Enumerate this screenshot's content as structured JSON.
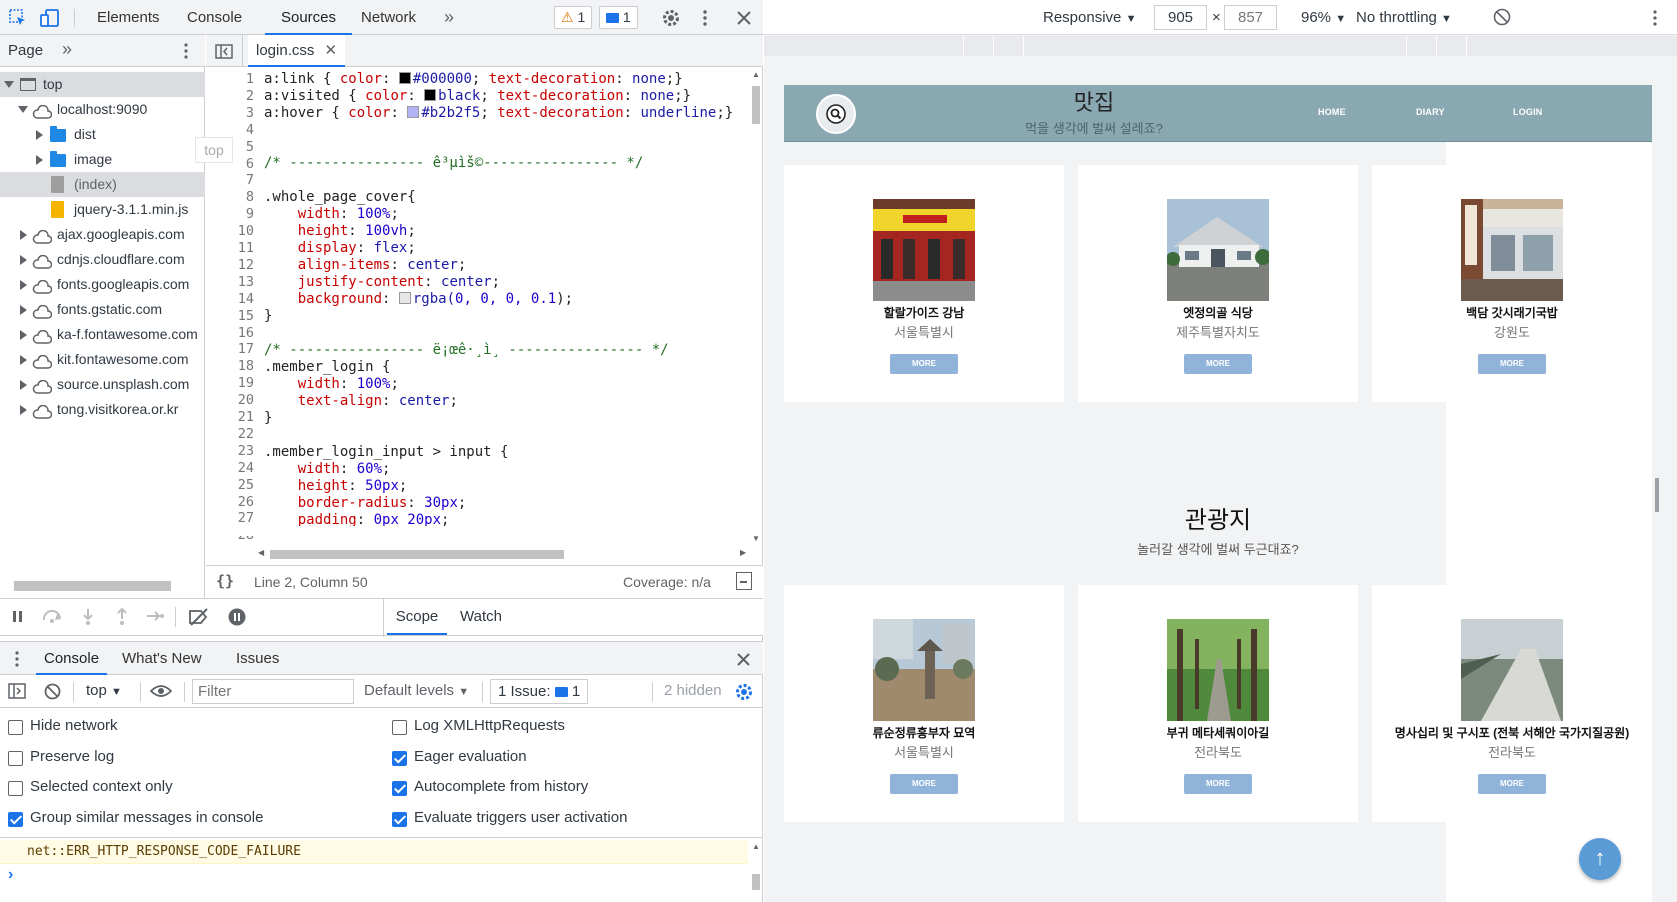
{
  "devtools": {
    "tabs": [
      "Elements",
      "Console",
      "Sources",
      "Network"
    ],
    "more_tabs": "»",
    "warnings_count": "1",
    "messages_count": "1"
  },
  "navigator": {
    "tab_label": "Page",
    "tooltip": "top",
    "rows": [
      {
        "label": "top"
      },
      {
        "label": "localhost:9090"
      },
      {
        "label": "dist"
      },
      {
        "label": "image"
      },
      {
        "label": "(index)"
      },
      {
        "label": "jquery-3.1.1.min.js"
      },
      {
        "label": "ajax.googleapis.com"
      },
      {
        "label": "cdnjs.cloudflare.com"
      },
      {
        "label": "fonts.googleapis.com"
      },
      {
        "label": "fonts.gstatic.com"
      },
      {
        "label": "ka-f.fontawesome.com"
      },
      {
        "label": "kit.fontawesome.com"
      },
      {
        "label": "source.unsplash.com"
      },
      {
        "label": "tong.visitkorea.or.kr"
      }
    ]
  },
  "editor": {
    "file_tab": "login.css",
    "status_left": "Line 2, Column 50",
    "status_right": "Coverage: n/a",
    "lines": [
      "1",
      "2",
      "3",
      "4",
      "5",
      "6",
      "7",
      "8",
      "9",
      "10",
      "11",
      "12",
      "13",
      "14",
      "15",
      "16",
      "17",
      "18",
      "19",
      "20",
      "21",
      "22",
      "23",
      "24",
      "25",
      "26",
      "27",
      "28"
    ],
    "code": {
      "l1_sel": "a:link { ",
      "l1_prop": "color",
      "l1_val": "#000000",
      "l1_prop2": "text-decoration",
      "l1_val2": "none",
      "l2_sel": "a:visited { ",
      "l2_prop": "color",
      "l2_val": "black",
      "l2_prop2": "text-decoration",
      "l2_val2": "none",
      "l3_sel": "a:hover { ",
      "l3_prop": "color",
      "l3_val": "#b2b2f5",
      "l3_prop2": "text-decoration",
      "l3_val2": "underline",
      "l6": "/* ---------------- ê³µìš©---------------- */",
      "l8": ".whole_page_cover{",
      "l9_p": "width",
      "l9_v": "100%",
      "l10_p": "height",
      "l10_v": "100vh",
      "l11_p": "display",
      "l11_v": "flex",
      "l12_p": "align-items",
      "l12_v": "center",
      "l13_p": "justify-content",
      "l13_v": "center",
      "l14_p": "background",
      "l14_v": "rgba(",
      "l14_n": "0, 0, 0, 0.1",
      "l15": "}",
      "l17": "/* ---------------- ë¡œê·¸ì¸ ---------------- */",
      "l18": ".member_login {",
      "l19_p": "width",
      "l19_v": "100%",
      "l20_p": "text-align",
      "l20_v": "center",
      "l21": "}",
      "l23": ".member_login_input > input {",
      "l24_p": "width",
      "l24_v": "60%",
      "l25_p": "height",
      "l25_v": "50px",
      "l26_p": "border-radius",
      "l26_v": "30px",
      "l27_p": "padding",
      "l27_v": "0px 20px"
    }
  },
  "debugger": {
    "tabs": [
      "Scope",
      "Watch"
    ]
  },
  "drawer": {
    "tabs": [
      "Console",
      "What's New",
      "Issues"
    ],
    "context": "top",
    "filter_placeholder": "Filter",
    "levels": "Default levels",
    "issues_label": "1 Issue:",
    "issues_count": "1",
    "hidden": "2 hidden",
    "settings": [
      {
        "label": "Hide network",
        "checked": false
      },
      {
        "label": "Log XMLHttpRequests",
        "checked": false
      },
      {
        "label": "Preserve log",
        "checked": false
      },
      {
        "label": "Eager evaluation",
        "checked": true
      },
      {
        "label": "Selected context only",
        "checked": false
      },
      {
        "label": "Autocomplete from history",
        "checked": true
      },
      {
        "label": "Group similar messages in console",
        "checked": true
      },
      {
        "label": "Evaluate triggers user activation",
        "checked": true
      }
    ],
    "error_message": "net::ERR_HTTP_RESPONSE_CODE_FAILURE",
    "prompt": "›"
  },
  "device_toolbar": {
    "mode": "Responsive",
    "width": "905",
    "times": "×",
    "height": "857",
    "zoom": "96%",
    "throttling": "No throttling"
  },
  "site": {
    "header_title": "맛집",
    "header_subtitle": "먹을 생각에 벌써 설레죠?",
    "nav": [
      "HOME",
      "DIARY",
      "LOGIN"
    ],
    "section2_title": "관광지",
    "section2_subtitle": "놀러갈 생각에 벌써 두근대죠?",
    "more_label": "MORE",
    "restaurants": [
      {
        "name": "할랄가이즈 강남",
        "region": "서울특별시"
      },
      {
        "name": "엣정의골 식당",
        "region": "제주특별자치도"
      },
      {
        "name": "백담 갓시래기국밥",
        "region": "강원도"
      }
    ],
    "attractions": [
      {
        "name": "류순정류흥부자 묘역",
        "region": "서울특별시"
      },
      {
        "name": "부귀 메타세쿼이아길",
        "region": "전라북도"
      },
      {
        "name": "명사십리 및 구시포 (전북 서해안 국가지질공원)",
        "region": "전라북도"
      }
    ],
    "scroll_top_icon": "↑"
  }
}
